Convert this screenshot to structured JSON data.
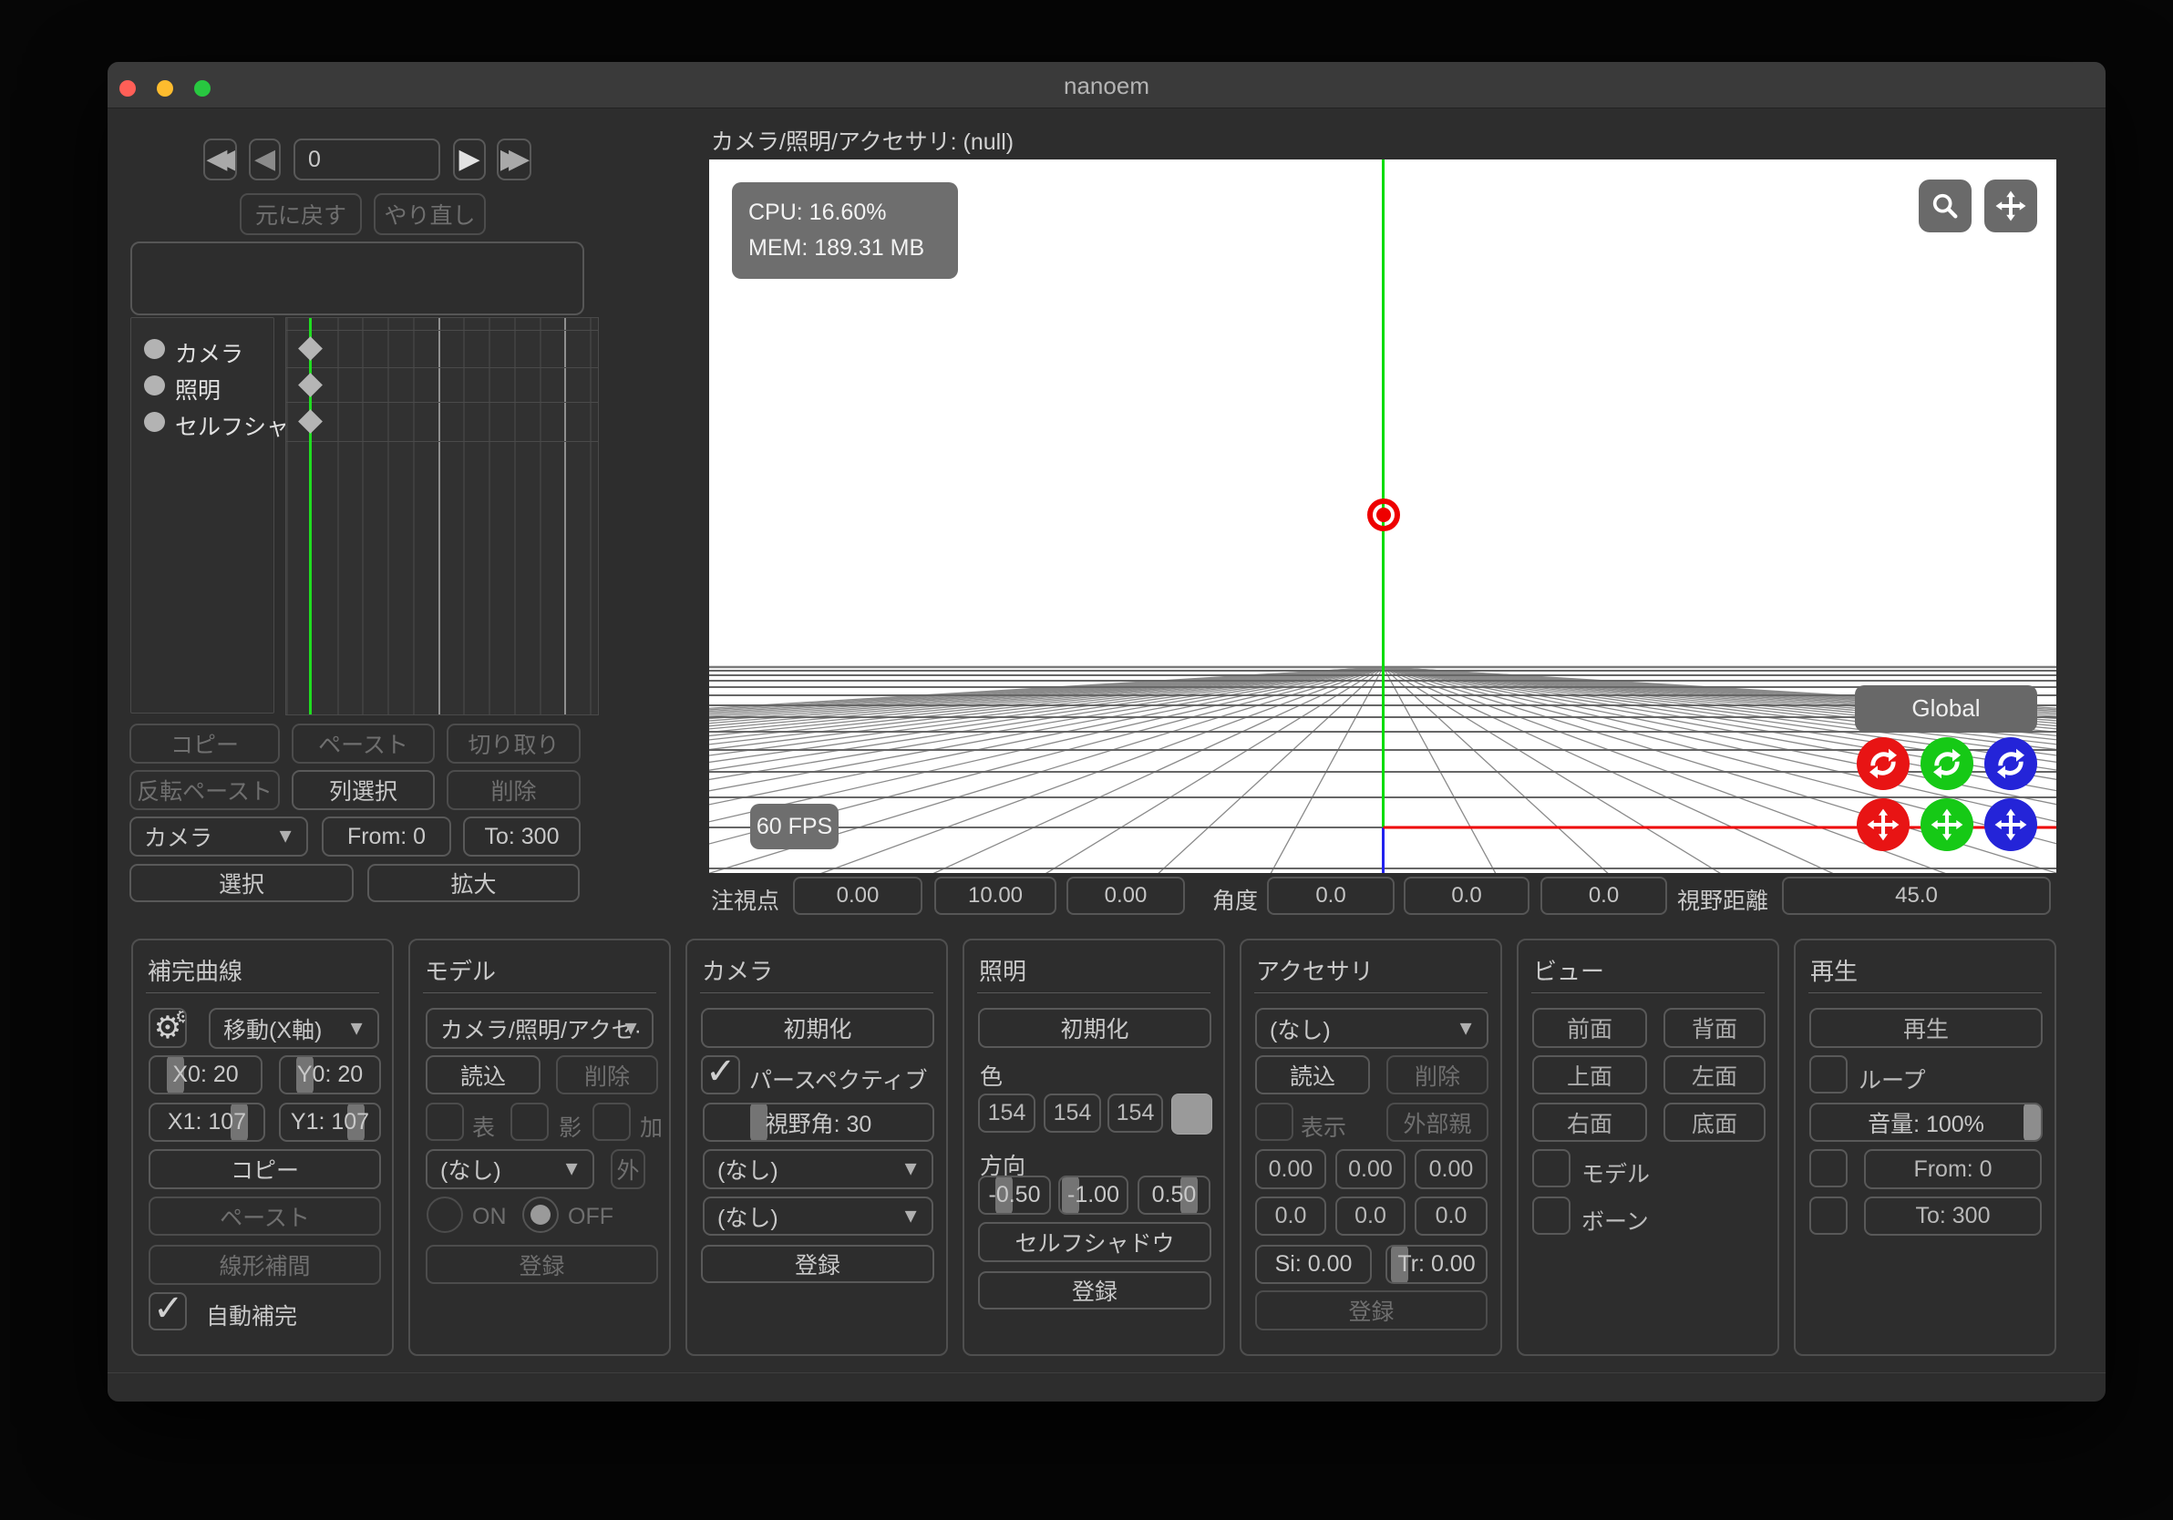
{
  "window": {
    "title": "nanoem"
  },
  "transport": {
    "frame_value": "0",
    "undo": "元に戻す",
    "redo": "やり直し"
  },
  "tracks": {
    "items": [
      "カメラ",
      "照明",
      "セルフシャド"
    ]
  },
  "timeline": {
    "copy": "コピー",
    "paste": "ペースト",
    "cut": "切り取り",
    "flip_paste": "反転ペースト",
    "column_select": "列選択",
    "delete": "削除",
    "target": "カメラ",
    "from": "From: 0",
    "to": "To: 300",
    "select": "選択",
    "expand": "拡大"
  },
  "viewport": {
    "header": "カメラ/照明/アクセサリ: (null)",
    "cpu": "CPU: 16.60%",
    "mem": "MEM: 189.31 MB",
    "fps": "60 FPS",
    "coord_space": "Global"
  },
  "status": {
    "lookat_label": "注視点",
    "lookat": [
      "0.00",
      "10.00",
      "0.00"
    ],
    "angle_label": "角度",
    "angle": [
      "0.0",
      "0.0",
      "0.0"
    ],
    "distance_label": "視野距離",
    "distance": "45.0"
  },
  "panels": {
    "interp": {
      "title": "補完曲線",
      "preset": "移動(X軸)",
      "x0": "X0: 20",
      "y0": "Y0: 20",
      "x1": "X1: 107",
      "y1": "Y1: 107",
      "copy": "コピー",
      "paste": "ペースト",
      "linear": "線形補間",
      "auto_complete": "自動補完"
    },
    "model": {
      "title": "モデル",
      "selector": "カメラ/照明/アクセ·",
      "load": "読込",
      "delete": "削除",
      "cb_front": "表",
      "cb_shadow": "影",
      "cb_add": "加",
      "parent": "(なし)",
      "ext": "外",
      "on": "ON",
      "off": "OFF",
      "register": "登録"
    },
    "camera": {
      "title": "カメラ",
      "init": "初期化",
      "perspective": "パースペクティブ",
      "fov": "視野角: 30",
      "sel1": "(なし)",
      "sel2": "(なし)",
      "register": "登録"
    },
    "light": {
      "title": "照明",
      "init": "初期化",
      "color_label": "色",
      "r": "154",
      "g": "154",
      "b": "154",
      "swatch_color": "#9a9a9a",
      "dir_label": "方向",
      "dx": "-0.50",
      "dy": "-1.00",
      "dz": "0.50",
      "self_shadow": "セルフシャドウ",
      "register": "登録"
    },
    "accessory": {
      "title": "アクセサリ",
      "selector": "(なし)",
      "load": "読込",
      "delete": "削除",
      "visible": "表示",
      "outside_parent": "外部親",
      "t": [
        "0.00",
        "0.00",
        "0.00"
      ],
      "r": [
        "0.0",
        "0.0",
        "0.0"
      ],
      "si": "Si: 0.00",
      "tr": "Tr: 0.00",
      "register": "登録"
    },
    "view": {
      "title": "ビュー",
      "front": "前面",
      "back": "背面",
      "top": "上面",
      "left": "左面",
      "right": "右面",
      "bottom": "底面",
      "model": "モデル",
      "bone": "ボーン"
    },
    "play": {
      "title": "再生",
      "play": "再生",
      "loop": "ループ",
      "volume": "音量: 100%",
      "from": "From: 0",
      "to": "To: 300"
    }
  }
}
